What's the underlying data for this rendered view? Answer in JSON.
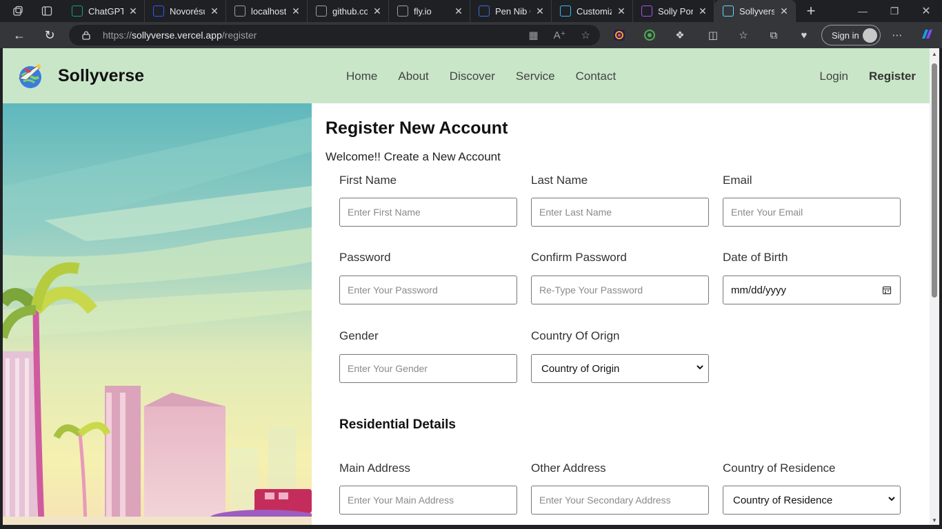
{
  "browser": {
    "tabs": [
      {
        "title": "ChatGPT",
        "icon": "chatgpt-icon",
        "color": "#10a37f"
      },
      {
        "title": "Novorésu",
        "icon": "novoresume-icon",
        "color": "#2e5bff"
      },
      {
        "title": "localhost",
        "icon": "page-icon",
        "color": "#9aa0a6"
      },
      {
        "title": "github.cor",
        "icon": "page-icon",
        "color": "#9aa0a6"
      },
      {
        "title": "fly.io",
        "icon": "page-icon",
        "color": "#9aa0a6"
      },
      {
        "title": "Pen Nib C",
        "icon": "flag-icon",
        "color": "#3b6ed8"
      },
      {
        "title": "Customizi",
        "icon": "tailwind-icon",
        "color": "#38bdf8"
      },
      {
        "title": "Solly Portf",
        "icon": "vite-icon",
        "color": "#a855f7"
      },
      {
        "title": "Sollyverse",
        "icon": "react-icon",
        "color": "#61dafb",
        "active": true
      }
    ],
    "url_prefix": "https://",
    "url_host": "sollyverse.vercel.app",
    "url_path": "/register",
    "signin_label": "Sign in"
  },
  "site": {
    "brand": "Sollyverse",
    "nav": [
      "Home",
      "About",
      "Discover",
      "Service",
      "Contact"
    ],
    "login": "Login",
    "register": "Register"
  },
  "form": {
    "title": "Register New Account",
    "subtitle": "Welcome!! Create a New Account",
    "first_name": {
      "label": "First Name",
      "placeholder": "Enter First Name"
    },
    "last_name": {
      "label": "Last Name",
      "placeholder": "Enter Last Name"
    },
    "email": {
      "label": "Email",
      "placeholder": "Enter Your Email"
    },
    "password": {
      "label": "Password",
      "placeholder": "Enter Your Password"
    },
    "confirm_password": {
      "label": "Confirm Password",
      "placeholder": "Re-Type Your Password"
    },
    "dob": {
      "label": "Date of Birth",
      "value": "mm/dd/yyyy"
    },
    "gender": {
      "label": "Gender",
      "placeholder": "Enter Your Gender"
    },
    "country_origin": {
      "label": "Country Of Orign",
      "value": "Country of Origin"
    },
    "residential_title": "Residential Details",
    "main_address": {
      "label": "Main Address",
      "placeholder": "Enter Your Main Address"
    },
    "other_address": {
      "label": "Other Address",
      "placeholder": "Enter Your Secondary Address"
    },
    "country_residence": {
      "label": "Country of Residence",
      "value": "Country of Residence"
    }
  },
  "colors": {
    "header_bg": "#c9e6c9",
    "browser_bg": "#35363a"
  }
}
